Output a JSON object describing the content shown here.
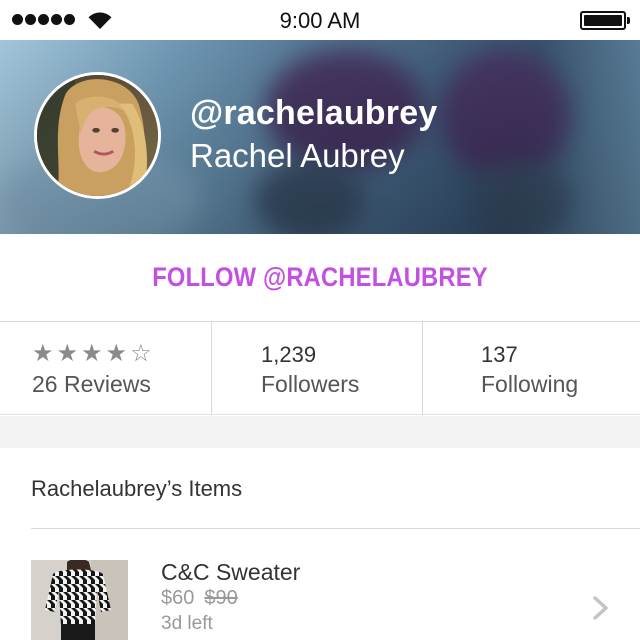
{
  "status_bar": {
    "time": "9:00 AM",
    "signal_bars": 5,
    "icons": [
      "signal-dots-icon",
      "wifi-icon",
      "battery-icon"
    ],
    "battery_level": 1.0
  },
  "profile": {
    "handle": "@rachelaubrey",
    "name": "Rachel Aubrey",
    "avatar_icon": "avatar"
  },
  "follow": {
    "label": "FOLLOW @RACHELAUBREY",
    "color": "#c350e3"
  },
  "stats": {
    "rating": 4,
    "rating_max": 5,
    "reviews_label": "26 Reviews",
    "followers_value": "1,239",
    "followers_label": "Followers",
    "following_value": "137",
    "following_label": "Following"
  },
  "items": {
    "title": "Rachelaubrey’s Items",
    "list": [
      {
        "name": "C&C Sweater",
        "price": "$60",
        "original_price": "$90",
        "stock": "3d left",
        "icon": "chevron-right-icon"
      }
    ]
  }
}
